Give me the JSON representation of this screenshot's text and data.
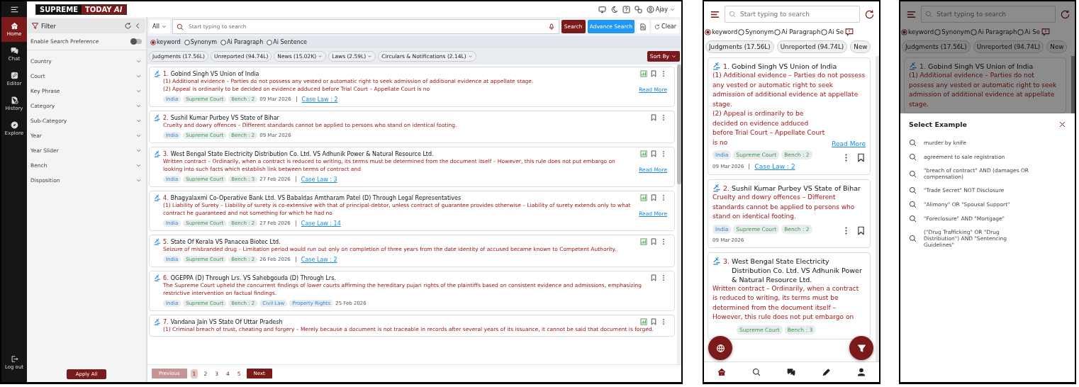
{
  "desktop": {
    "logo": {
      "left": "SUPREME",
      "right": "TODAY",
      "suffix": "AI"
    },
    "user": {
      "name": "Ajay"
    },
    "nav": [
      {
        "label": "Home",
        "selected": true
      },
      {
        "label": "Chat",
        "selected": false
      },
      {
        "label": "Editor",
        "selected": false
      },
      {
        "label": "History",
        "selected": false
      },
      {
        "label": "Explore",
        "selected": false
      }
    ],
    "logout": "Log out",
    "filter": {
      "title": "Filter",
      "preference": {
        "label": "Enable Search Preference",
        "on": false
      },
      "items": [
        "Country",
        "Court",
        "Key Phrase",
        "Category",
        "Sub-Category",
        "Year",
        "Year Slider",
        "Bench",
        "Disposition"
      ],
      "apply_button": "Apply All"
    },
    "search": {
      "scope": "All",
      "placeholder": "Start typing to search",
      "search_button": "Search",
      "advance_button": "Advance Search",
      "clear_button": "Clear"
    },
    "modes": [
      {
        "label": "keyword",
        "selected": true
      },
      {
        "label": "Synonym",
        "selected": false
      },
      {
        "label": "Ai Paragraph",
        "selected": false
      },
      {
        "label": "Ai Sentence",
        "selected": false
      }
    ],
    "chips": [
      {
        "label": "Judgments (17.56L)",
        "dropdown": false
      },
      {
        "label": "Unreported (94.74L)",
        "dropdown": false
      },
      {
        "label": "News (15.02K)",
        "dropdown": true
      },
      {
        "label": "Laws (2.59L)",
        "dropdown": true
      },
      {
        "label": "Circulars & Notifications (2.14L)",
        "dropdown": true
      }
    ],
    "sort_button": "Sort By",
    "results": [
      {
        "number": "1.",
        "title": "Gobind Singh VS Union of India",
        "summary": [
          "(1) Additional evidence – Parties do not possess any vested or automatic right to seek admission of additional evidence at appellate stage.",
          "(2) Appeal is ordinarily to be decided on evidence adduced before Trial Court – Appellate Court is no"
        ],
        "read_more": "Read More",
        "tags": [
          {
            "label": "India",
            "kind": "country"
          },
          {
            "label": "Supreme Court",
            "kind": "court"
          },
          {
            "label": "Bench : 2",
            "kind": "bench"
          }
        ],
        "date": "09 Mar 2026",
        "case_law": "Case Law : 2",
        "chart": true
      },
      {
        "number": "2.",
        "title": "Sushil Kumar Purbey VS State of Bihar",
        "summary": [
          "Cruelty and dowry offences – Different standards cannot be applied to persons who stand on identical footing."
        ],
        "tags": [
          {
            "label": "India",
            "kind": "country"
          },
          {
            "label": "Supreme Court",
            "kind": "court"
          },
          {
            "label": "Bench : 2",
            "kind": "bench"
          }
        ],
        "date": "09 Mar 2026",
        "chart": false
      },
      {
        "number": "3.",
        "title": "West Bengal State Electricity Distribution Co. Ltd. VS Adhunik Power & Natural Resource Ltd.",
        "summary": [
          "Written contract – Ordinarily, when a contract is reduced to writing, its terms must be determined from the document itself – However, this rule does not put embargo on looking into such facts which establish link between terms of contract and"
        ],
        "read_more": "Read More",
        "tags": [
          {
            "label": "India",
            "kind": "country"
          },
          {
            "label": "Supreme Court",
            "kind": "court"
          },
          {
            "label": "Bench : 3",
            "kind": "bench"
          }
        ],
        "date": "27 Feb 2026",
        "case_law": "Case Law : 3",
        "chart": true
      },
      {
        "number": "4.",
        "title": "Bhagyalaxmi Co-Operative Bank Ltd. VS Babaldas Amtharam Patel (D) Through Legal Representatives",
        "summary": [
          "(1) Liability of Surety – Liability of surety is co-extensive with that of principal-debtor, unless contract of guarantee provides otherwise – Liability of surety extends only to what contract he guaranteed and not something for which he had no"
        ],
        "read_more": "Read More",
        "tags": [
          {
            "label": "India",
            "kind": "country"
          },
          {
            "label": "Supreme Court",
            "kind": "court"
          },
          {
            "label": "Bench : 2",
            "kind": "bench"
          }
        ],
        "date": "27 Feb 2026",
        "case_law": "Case Law : 14",
        "chart": true
      },
      {
        "number": "5.",
        "title": "State Of Kerala VS Panacea Biotec Ltd.",
        "summary": [
          "Seizure of misbranded drug – Limitation period would run out only on completion of three years from the date identity of accused became known to Competent Authority."
        ],
        "tags": [
          {
            "label": "India",
            "kind": "country"
          },
          {
            "label": "Supreme Court",
            "kind": "court"
          },
          {
            "label": "Bench : 2",
            "kind": "bench"
          }
        ],
        "date": "26 Feb 2026",
        "case_law": "Case Law : 2",
        "chart": true
      },
      {
        "number": "6.",
        "title": "OGEPPA (D) Through Lrs. VS Sahebgouda (D) Through Lrs.",
        "summary": [
          "The Supreme Court upheld the concurrent findings of lower courts affirming the hereditary pujari rights of the plaintiffs based on consistent evidence and admissions, emphasizing restrictive intervention on factual findings."
        ],
        "tags": [
          {
            "label": "India",
            "kind": "country"
          },
          {
            "label": "Supreme Court",
            "kind": "court"
          },
          {
            "label": "Bench : 2",
            "kind": "bench"
          },
          {
            "label": "Civil Law",
            "kind": "subject"
          },
          {
            "label": "Property Rights",
            "kind": "subject"
          }
        ],
        "date": "25 Feb 2026",
        "chart": false
      },
      {
        "number": "7.",
        "title": "Vandana Jain VS State Of Uttar Pradesh",
        "summary": [
          "(1) Criminal breach of trust, cheating and forgery – Merely because a document is not traceable in records after several years of its issuance, it cannot be said that document is forged."
        ],
        "chart": true
      }
    ],
    "pagination": {
      "previous": {
        "label": "Previous",
        "disabled": true
      },
      "pages": [
        {
          "label": "1",
          "selected": true
        },
        {
          "label": "2",
          "selected": false
        },
        {
          "label": "3",
          "selected": false
        },
        {
          "label": "4",
          "selected": false
        },
        {
          "label": "5",
          "selected": false
        }
      ],
      "next": "Next"
    }
  },
  "mobile": {
    "placeholder": "Start typing to search",
    "modes": [
      {
        "label": "keyword",
        "selected": true
      },
      {
        "label": "Synonym",
        "selected": false
      },
      {
        "label": "Ai Paragraph",
        "selected": false
      },
      {
        "label": "Ai Se",
        "selected": false
      }
    ],
    "chips": [
      "Judgments (17.56L)",
      "Unreported (94.74L)",
      "New"
    ],
    "results": [
      {
        "number": "1.",
        "title": "Gobind Singh VS Union of India",
        "summary": [
          "(1) Additional evidence – Parties do not possess any vested or automatic right to seek admission of additional evidence at appellate stage.",
          "(2) Appeal is ordinarily to be decided on evidence adduced before Trial Court – Appellate Court is no"
        ],
        "read_more": "Read More",
        "tags": [
          {
            "label": "India",
            "kind": "country"
          },
          {
            "label": "Supreme Court",
            "kind": "court"
          },
          {
            "label": "Bench : 2",
            "kind": "bench"
          }
        ],
        "date": "09 Mar 2026",
        "case_law": "Case Law : 2"
      },
      {
        "number": "2.",
        "title": "Sushil Kumar Purbey VS State of Bihar",
        "summary": [
          "Cruelty and dowry offences – Different standards cannot be applied to persons who stand on identical footing."
        ],
        "tags": [
          {
            "label": "India",
            "kind": "country"
          },
          {
            "label": "Supreme Court",
            "kind": "court"
          },
          {
            "label": "Bench : 2",
            "kind": "bench"
          }
        ],
        "date": "09 Mar 2026"
      },
      {
        "number": "3.",
        "title": "West Bengal State Electricity Distribution Co. Ltd. VS Adhunik Power & Natural Resource Ltd.",
        "summary": [
          "Written contract – Ordinarily, when a contract is reduced to writing, its terms must be determined from the document itself – However, this rule does not put embargo on"
        ],
        "tags": [
          {
            "label": "Supreme Court",
            "kind": "court"
          },
          {
            "label": "Bench : 3",
            "kind": "bench"
          }
        ]
      }
    ],
    "bottom_nav": [
      {
        "selected": true
      },
      {
        "selected": false
      },
      {
        "selected": false
      },
      {
        "selected": false
      },
      {
        "selected": false
      }
    ]
  },
  "mobile_examples": {
    "background": {
      "placeholder": "Start typing to search",
      "modes": [
        {
          "label": "keyword",
          "selected": true
        },
        {
          "label": "Synonym",
          "selected": false
        },
        {
          "label": "Ai Paragraph",
          "selected": false
        },
        {
          "label": "Ai Se",
          "selected": false
        }
      ],
      "chips": [
        "Judgments (17.56L)",
        "Unreported (94.74L)",
        "New"
      ],
      "result": {
        "number": "1.",
        "title": "Gobind Singh VS Union of India",
        "summary": [
          "(1) Additional evidence – Parties do not possess any vested or automatic right to seek admission of additional evidence at appellate stage."
        ]
      }
    },
    "sheet": {
      "title": "Select Example",
      "examples": [
        "murder by knife",
        "agreement to sale registration",
        "\"breach of contract\" AND (damages OR compensation)",
        "\"Trade Secret\" NOT Disclosure",
        "\"Alimony\" OR \"Spousal Support\"",
        "\"Foreclosure\" AND \"Mortgage\"",
        "(\"Drug Trafficking\" OR \"Drug Distribution\") AND \"Sentencing Guidelines\""
      ]
    }
  }
}
